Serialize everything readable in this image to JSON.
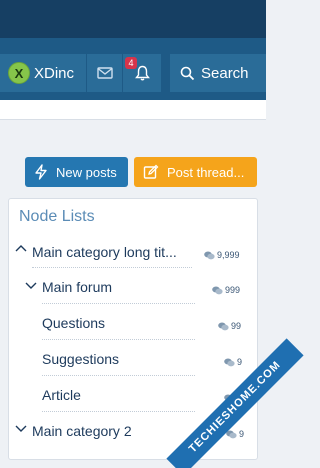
{
  "header": {
    "username": "XDinc",
    "avatar_letter": "X",
    "alerts_badge": "4",
    "search_label": "Search"
  },
  "actions": {
    "new_posts": "New posts",
    "post_thread": "Post thread..."
  },
  "node_list": {
    "title": "Node Lists",
    "items": [
      {
        "label": "Main category long tit...",
        "count": "9,999"
      },
      {
        "label": "Main forum",
        "count": "999"
      },
      {
        "label": "Questions",
        "count": "99"
      },
      {
        "label": "Suggestions",
        "count": "9"
      },
      {
        "label": "Article",
        "count": "9"
      },
      {
        "label": "Main category 2",
        "count": "9"
      }
    ]
  },
  "watermark": "TECHIESHOME.COM",
  "colors": {
    "header_dark": "#163f63",
    "navbar": "#1e5a86",
    "nav_item": "#2a6c98",
    "primary_button": "#2577b1",
    "cta_button": "#f5a41b",
    "badge": "#d6344b",
    "block_title": "#5b8cb6"
  },
  "icons": {
    "inbox": "envelope-icon",
    "alerts": "bell-icon",
    "search": "search-icon",
    "new_posts": "bolt-icon",
    "post_thread": "edit-icon",
    "chevron": "chevron-icon",
    "count": "comments-icon"
  }
}
